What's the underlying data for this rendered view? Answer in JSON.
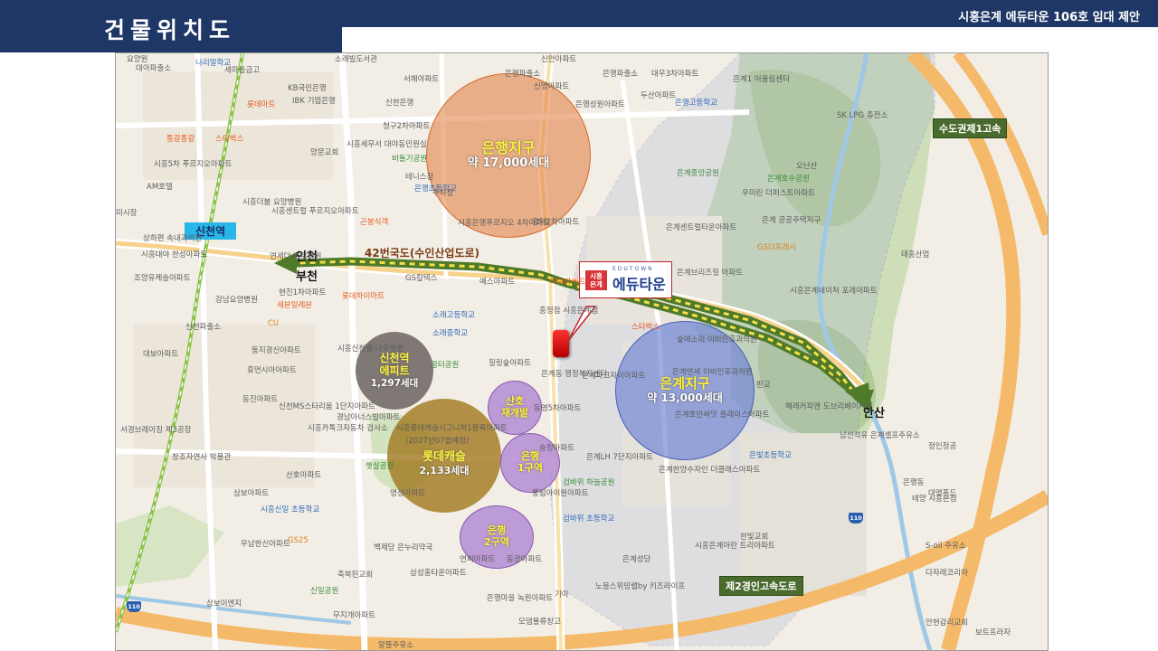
{
  "header": {
    "page_title": "건물위치도",
    "proposal_title": "시흥은계 에듀타운 106호 임대 제안"
  },
  "colors": {
    "header_bg": "#1f3766",
    "eungye_zone": "#6a7fd6",
    "eunhaeng_zone": "#e07a3a",
    "arrow_green": "#4f7a2a",
    "arrow_yellow": "#f5e04a"
  },
  "zones": {
    "eunhaeng": {
      "name": "은행지구",
      "count": "약 17,000세대"
    },
    "eungye": {
      "name": "은계지구",
      "count": "약 13,000세대"
    },
    "sincheon": {
      "name_line1": "신천역",
      "name_line2": "에피트",
      "count": "1,297세대"
    },
    "lotte": {
      "name": "롯데캐슬",
      "count": "2,133세대"
    },
    "sanho": {
      "name_line1": "산호",
      "name_line2": "재개발"
    },
    "eunhaeng1": {
      "name_line1": "은행",
      "name_line2": "1구역"
    },
    "eunhaeng2": {
      "name_line1": "은행",
      "name_line2": "2구역"
    }
  },
  "roads": {
    "route42": "42번국도(수인산업도로)",
    "expressway_sudogwon": "수도권제1고속",
    "expressway_2nd": "제2경인고속도로"
  },
  "directions": {
    "incheon": "인천",
    "bucheon": "부천",
    "ansan": "안산"
  },
  "station": {
    "label": "신천역"
  },
  "callout": {
    "badge_top": "시흥",
    "badge_bottom": "은계",
    "brand_en": "EDUTOWN",
    "brand_ko": "에듀타운"
  },
  "map_labels": [
    "요양원",
    "대아파출소",
    "나리얼학교",
    "세마을금고",
    "KB국민은행",
    "IBK 기업은행",
    "신한은행",
    "소래빌도서관",
    "서해아파트",
    "은행파출소",
    "신명아파트",
    "은행성원아파트",
    "신안아파트",
    "은행파출소",
    "대우3차아파트",
    "두산아파트",
    "은행고등학교",
    "은계1 어울림센터",
    "SK LPG 충전소",
    "오난산",
    "은계중앙공원",
    "은계호수공원",
    "우미린 더퍼스트아파트",
    "은계센트럴타운아파트",
    "은계 공공주택지구",
    "GS더프레시",
    "은계브리즈힐 아파트",
    "시흥은계네이처 포레아파트",
    "태흥산업",
    "스타벅스",
    "숲에소리 이비인후과의원",
    "은계파크자이아파트",
    "은계연세 이비인후과의원",
    "은계호반써밋 플레이스아파트",
    "은계한양수자인 더클래스아파트",
    "은계LH 7단지아파트",
    "시흥은계아란 트리아파트",
    "은빛초등학교",
    "은계성당",
    "노블스위밍랩by 키즈라이프",
    "남선석유 은계셀프주유소",
    "정인정공",
    "대명푸드",
    "은행동",
    "테양 시흥본점",
    "S-oil 주유소",
    "다자레코리아",
    "안현감리교회",
    "보트프라자",
    "한빛교회",
    "기아",
    "모뎀물류창고",
    "은행마을 녹원아파트",
    "삼성홍타운아파트",
    "연희아파트",
    "동광아파트",
    "풍림아이원아파트",
    "검바위 하늘공원",
    "검바위 초등학교",
    "숭정아파트",
    "동영5차아파트",
    "시흥롯데캐슬시그니처1블록아파트",
    "(2027년07월예정)",
    "햇살공원",
    "명성아파트",
    "백제당 은누리약국",
    "축복된교회",
    "신일공원",
    "삼보이엔지",
    "무지개아파트",
    "알뜰주유소",
    "산호아파트",
    "GS25",
    "시흥신일 초등학교",
    "우남한신아파트",
    "삼보아파트",
    "서경브레이징 제3공장",
    "창조자연사 박물관",
    "시흥카톡크자동차 검사소",
    "경남아너스빌아파트",
    "신천MS스타리움 1단지아파트",
    "동진아파트",
    "휴먼시아아파트",
    "둥지경신아파트",
    "대보아파트",
    "신천파출소",
    "강남요양병원",
    "조양유케슬아파트",
    "상하편 속내과의원",
    "시흥5차 푸르지오아파트",
    "AM호텔",
    "미시장",
    "시흥대야 한성아파트",
    "통갈통갈",
    "스타벅스",
    "시흥더붐 요양병원",
    "시흥센트럴 푸르지오아파트",
    "양문교회",
    "시흥세무서 대야동민원실",
    "청구2차아파트",
    "비둘기공원",
    "테니스장",
    "은행초등학교",
    "주차장",
    "곤봉식객",
    "시흥은행푸르지오 4차아파트",
    "광덕2차아파트",
    "미보바게트",
    "소래고등학교",
    "소래중학교",
    "GS칼텍스",
    "예스아파트",
    "현진1차아파트",
    "롯데하이마트",
    "CU",
    "시흥신천웰 나우병원",
    "꿈터공원",
    "힐링숲아파트",
    "은계동 행정복지센터",
    "연세더 바로병원",
    "세븐일레븐",
    "롯데마트",
    "흥정점 시흥은계점",
    "판교",
    "해레커피앤 도브리베이커리"
  ]
}
